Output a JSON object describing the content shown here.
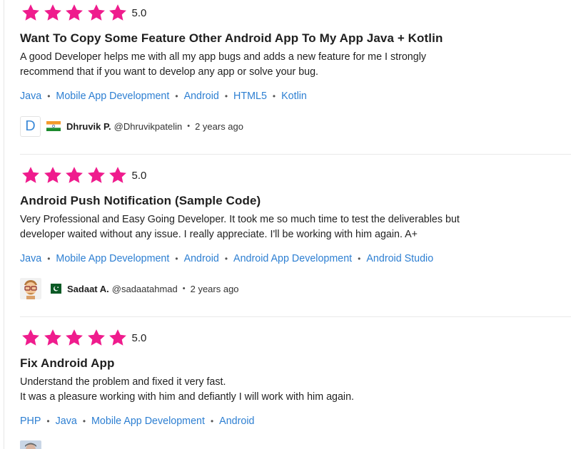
{
  "colors": {
    "star": "#ef1c8d",
    "link": "#2d7fd2",
    "text": "#1f1f1f",
    "divider": "#e9e9e9"
  },
  "reviews": [
    {
      "rating": 5,
      "score": "5.0",
      "title": "Want To Copy Some Feature Other Android App To My App Java + Kotlin",
      "comment": "A good Developer helps me with all my app bugs and adds a new feature for me I strongly recommend that if you want to develop any app or solve your bug.",
      "skills": [
        "Java",
        "Mobile App Development",
        "Android",
        "HTML5",
        "Kotlin"
      ],
      "reviewer": {
        "avatar_letter": "D",
        "flag": "india-flag-icon",
        "name": "Dhruvik P.",
        "handle": "@Dhruvikpatelin",
        "time": "2 years ago"
      }
    },
    {
      "rating": 5,
      "score": "5.0",
      "title": "Android Push Notification (Sample Code)",
      "comment": "Very Professional and Easy Going Developer. It took me so much time to test the deliverables but developer waited without any issue. I really appreciate. I'll be working with him again. A+",
      "skills": [
        "Java",
        "Mobile App Development",
        "Android",
        "Android App Development",
        "Android Studio"
      ],
      "reviewer": {
        "avatar": "cartoon-avatar-icon",
        "flag": "pakistan-flag-icon",
        "name": "Sadaat A.",
        "handle": "@sadaatahmad",
        "time": "2 years ago"
      }
    },
    {
      "rating": 5,
      "score": "5.0",
      "title": "Fix Android App",
      "comment_lines": [
        "Understand the problem and fixed it very fast.",
        "It was a pleasure working with him and defiantly I will work with him again."
      ],
      "skills": [
        "PHP",
        "Java",
        "Mobile App Development",
        "Android"
      ]
    }
  ]
}
